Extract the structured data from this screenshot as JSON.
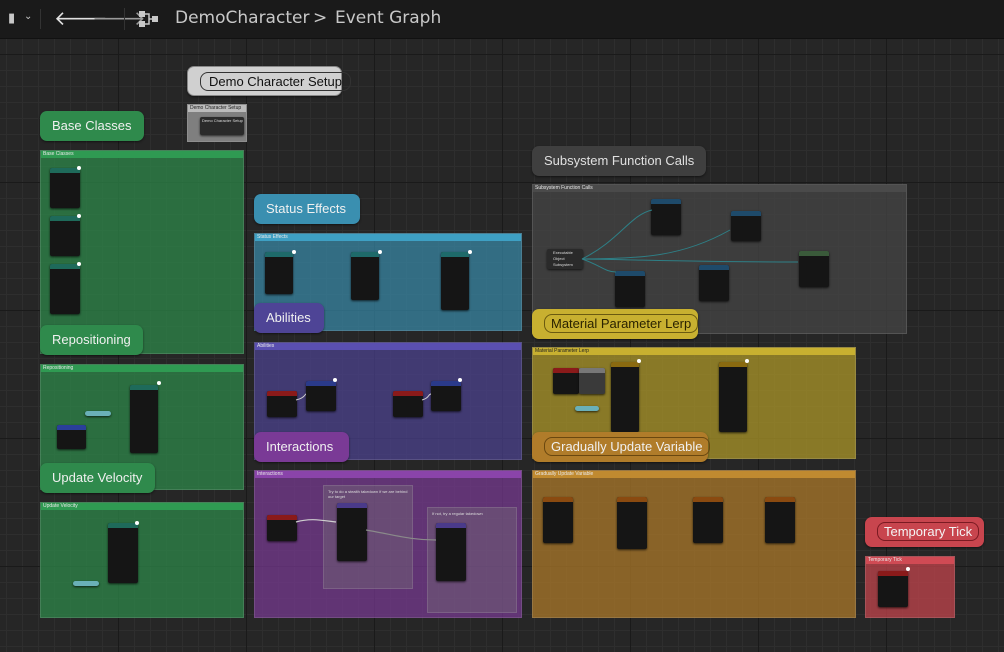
{
  "toolbar": {
    "breadcrumb_root": "DemoCharacter",
    "breadcrumb_separator": ">",
    "breadcrumb_current": "Event Graph"
  },
  "comments": [
    {
      "id": "demo-setup",
      "bubble": "Demo Character Setup",
      "box_title": "Demo Character Setup",
      "inner": "Demo Character Setup",
      "color": "#d4d4d4"
    },
    {
      "id": "base-classes",
      "bubble": "Base Classes",
      "box_title": "Base Classes",
      "color": "#2f8a4c"
    },
    {
      "id": "repositioning",
      "bubble": "Repositioning",
      "box_title": "Repositioning",
      "color": "#2f8a4c"
    },
    {
      "id": "update-velocity",
      "bubble": "Update Velocity",
      "box_title": "Update Velocity",
      "color": "#2f8a4c"
    },
    {
      "id": "status-effects",
      "bubble": "Status Effects",
      "box_title": "Status Effects",
      "color": "#3a8fb0"
    },
    {
      "id": "abilities",
      "bubble": "Abilities",
      "box_title": "Abilities",
      "color": "#4e4496"
    },
    {
      "id": "interactions",
      "bubble": "Interactions",
      "box_title": "Interactions",
      "color": "#7a3a96"
    },
    {
      "id": "subsystem",
      "bubble": "Subsystem Function Calls",
      "box_title": "Subsystem Function Calls",
      "color": "#3f3f3f"
    },
    {
      "id": "material-lerp",
      "bubble": "Material Parameter Lerp",
      "box_title": "Material Parameter Lerp",
      "color": "#b09a28"
    },
    {
      "id": "gradual-update",
      "bubble": "Gradually Update Variable",
      "box_title": "Gradually Update Variable",
      "color": "#b07c2a"
    },
    {
      "id": "temp-tick",
      "bubble": "Temporary Tick",
      "box_title": "Temporary Tick",
      "color": "#c8454e"
    }
  ],
  "notes": {
    "interaction_note_1": "Try to do a stealth takedown if we are behind our target",
    "interaction_note_2": "If not, try a regular takedown",
    "subsystem_node_label_1": "Executable",
    "subsystem_node_label_2": "Object",
    "subsystem_node_label_3": "Subsystem"
  }
}
